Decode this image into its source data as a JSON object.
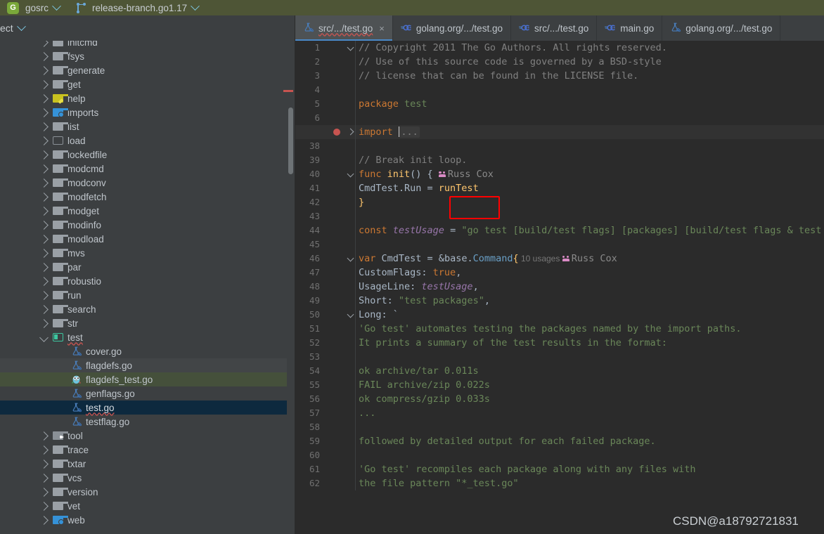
{
  "topbar": {
    "project_badge": "G",
    "project_name": "gosrc",
    "branch_icon": "vcs-branch-icon",
    "branch_name": "release-branch.go1.17",
    "project_chevron": "chevron-down-icon",
    "branch_chevron": "chevron-down-icon"
  },
  "sidebar_header": {
    "label": "ect",
    "chevron": "chevron-down-icon"
  },
  "tree": [
    {
      "label": "initcmd",
      "indent": 0,
      "arrow": "right",
      "icon": "folder",
      "state": "clipped"
    },
    {
      "label": "fsys",
      "indent": 0,
      "arrow": "right",
      "icon": "folder"
    },
    {
      "label": "generate",
      "indent": 0,
      "arrow": "right",
      "icon": "folder"
    },
    {
      "label": "get",
      "indent": 0,
      "arrow": "right",
      "icon": "folder"
    },
    {
      "label": "help",
      "indent": 0,
      "arrow": "right",
      "icon": "folder-yellow"
    },
    {
      "label": "imports",
      "indent": 0,
      "arrow": "right",
      "icon": "folder-blue"
    },
    {
      "label": "list",
      "indent": 0,
      "arrow": "right",
      "icon": "folder"
    },
    {
      "label": "load",
      "indent": 0,
      "arrow": "right",
      "icon": "folder-outline"
    },
    {
      "label": "lockedfile",
      "indent": 0,
      "arrow": "right",
      "icon": "folder"
    },
    {
      "label": "modcmd",
      "indent": 0,
      "arrow": "right",
      "icon": "folder"
    },
    {
      "label": "modconv",
      "indent": 0,
      "arrow": "right",
      "icon": "folder"
    },
    {
      "label": "modfetch",
      "indent": 0,
      "arrow": "right",
      "icon": "folder"
    },
    {
      "label": "modget",
      "indent": 0,
      "arrow": "right",
      "icon": "folder"
    },
    {
      "label": "modinfo",
      "indent": 0,
      "arrow": "right",
      "icon": "folder"
    },
    {
      "label": "modload",
      "indent": 0,
      "arrow": "right",
      "icon": "folder"
    },
    {
      "label": "mvs",
      "indent": 0,
      "arrow": "right",
      "icon": "folder"
    },
    {
      "label": "par",
      "indent": 0,
      "arrow": "right",
      "icon": "folder"
    },
    {
      "label": "robustio",
      "indent": 0,
      "arrow": "right",
      "icon": "folder"
    },
    {
      "label": "run",
      "indent": 0,
      "arrow": "right",
      "icon": "folder"
    },
    {
      "label": "search",
      "indent": 0,
      "arrow": "right",
      "icon": "folder"
    },
    {
      "label": "str",
      "indent": 0,
      "arrow": "right",
      "icon": "folder"
    },
    {
      "label": "test",
      "indent": 0,
      "arrow": "down",
      "icon": "folder-open-teal",
      "squiggle": true
    },
    {
      "label": "cover.go",
      "indent": 1,
      "arrow": "none",
      "icon": "go-test-file"
    },
    {
      "label": "flagdefs.go",
      "indent": 1,
      "arrow": "none",
      "icon": "go-test-file",
      "row": "hover"
    },
    {
      "label": "flagdefs_test.go",
      "indent": 1,
      "arrow": "none",
      "icon": "gopher-file",
      "row": "sel-green"
    },
    {
      "label": "genflags.go",
      "indent": 1,
      "arrow": "none",
      "icon": "go-test-file"
    },
    {
      "label": "test.go",
      "indent": 1,
      "arrow": "none",
      "icon": "go-test-file",
      "row": "sel-blue",
      "squiggle": true
    },
    {
      "label": "testflag.go",
      "indent": 1,
      "arrow": "none",
      "icon": "go-test-file"
    },
    {
      "label": "tool",
      "indent": 0,
      "arrow": "right",
      "icon": "folder-arrow"
    },
    {
      "label": "trace",
      "indent": 0,
      "arrow": "right",
      "icon": "folder"
    },
    {
      "label": "txtar",
      "indent": 0,
      "arrow": "right",
      "icon": "folder"
    },
    {
      "label": "vcs",
      "indent": 0,
      "arrow": "right",
      "icon": "folder"
    },
    {
      "label": "version",
      "indent": 0,
      "arrow": "right",
      "icon": "folder"
    },
    {
      "label": "vet",
      "indent": 0,
      "arrow": "right",
      "icon": "folder"
    },
    {
      "label": "web",
      "indent": 0,
      "arrow": "right",
      "icon": "folder-web"
    }
  ],
  "tabs": [
    {
      "label": "src/.../test.go",
      "icon": "go-test-file",
      "active": true,
      "close": "×"
    },
    {
      "label": "golang.org/.../test.go",
      "icon": "go-file",
      "active": false
    },
    {
      "label": "src/.../test.go",
      "icon": "go-file",
      "active": false
    },
    {
      "label": "main.go",
      "icon": "go-file",
      "active": false
    },
    {
      "label": "golang.org/.../test.go",
      "icon": "go-test-file",
      "active": false
    }
  ],
  "editor": {
    "lines": [
      {
        "n": "1",
        "fold": "down",
        "segs": [
          {
            "t": "// Copyright 2011 The Go Authors. All rights reserved.",
            "c": "cm"
          }
        ]
      },
      {
        "n": "2",
        "segs": [
          {
            "t": "// Use of this source code is governed by a BSD-style",
            "c": "cm"
          }
        ]
      },
      {
        "n": "3",
        "segs": [
          {
            "t": "// license that can be found in the LICENSE file.",
            "c": "cm"
          }
        ]
      },
      {
        "n": "4",
        "segs": []
      },
      {
        "n": "5",
        "segs": [
          {
            "t": "package ",
            "c": "kw"
          },
          {
            "t": "test",
            "c": "pkg"
          }
        ]
      },
      {
        "n": "6",
        "segs": []
      },
      {
        "n": "",
        "fold": "right",
        "breakpoint": true,
        "hl": true,
        "segs": [
          {
            "t": "import ",
            "c": "kw"
          },
          {
            "t": "CARET",
            "c": "caret"
          },
          {
            "t": "...",
            "c": "folded"
          }
        ]
      },
      {
        "n": "38",
        "segs": []
      },
      {
        "n": "39",
        "segs": [
          {
            "t": "// Break init loop.",
            "c": "cm"
          }
        ]
      },
      {
        "n": "40",
        "fold": "down",
        "segs": [
          {
            "t": "func ",
            "c": "kw"
          },
          {
            "t": "init",
            "c": "fn"
          },
          {
            "t": "() {",
            "c": "pln"
          },
          {
            "t": "  ",
            "c": "pln"
          },
          {
            "t": "PEOPLE",
            "c": "people"
          },
          {
            "t": "Russ Cox",
            "c": "inlay-user"
          }
        ]
      },
      {
        "n": "41",
        "segs": [
          {
            "t": "    CmdTest.Run = ",
            "c": "pln"
          },
          {
            "t": "runTest",
            "c": "fn"
          }
        ]
      },
      {
        "n": "42",
        "segs": [
          {
            "t": "    }",
            "c": "brace"
          }
        ]
      },
      {
        "n": "43",
        "segs": []
      },
      {
        "n": "44",
        "segs": [
          {
            "t": "const ",
            "c": "kw"
          },
          {
            "t": "testUsage",
            "c": "fld"
          },
          {
            "t": " = ",
            "c": "pln"
          },
          {
            "t": "\"go test [build/test flags] [packages] [build/test flags & test bin",
            "c": "str"
          }
        ]
      },
      {
        "n": "45",
        "segs": []
      },
      {
        "n": "46",
        "fold": "down",
        "segs": [
          {
            "t": "var ",
            "c": "kw"
          },
          {
            "t": "CmdTest",
            "c": "pln"
          },
          {
            "t": " = &",
            "c": "pln"
          },
          {
            "t": "base",
            "c": "pln"
          },
          {
            "t": ".",
            "c": "pln"
          },
          {
            "t": "Command",
            "c": "typ"
          },
          {
            "t": "{",
            "c": "brace"
          },
          {
            "t": "  10 usages  ",
            "c": "inlay"
          },
          {
            "t": "PEOPLE",
            "c": "people"
          },
          {
            "t": "Russ Cox",
            "c": "inlay-user"
          }
        ]
      },
      {
        "n": "47",
        "segs": [
          {
            "t": "    CustomFlags: ",
            "c": "pln"
          },
          {
            "t": "true",
            "c": "kw"
          },
          {
            "t": ",",
            "c": "pln"
          }
        ]
      },
      {
        "n": "48",
        "segs": [
          {
            "t": "    UsageLine:   ",
            "c": "pln"
          },
          {
            "t": "testUsage",
            "c": "fld"
          },
          {
            "t": ",",
            "c": "pln"
          }
        ]
      },
      {
        "n": "49",
        "segs": [
          {
            "t": "    Short:       ",
            "c": "pln"
          },
          {
            "t": "\"test packages\"",
            "c": "str"
          },
          {
            "t": ",",
            "c": "pln"
          }
        ]
      },
      {
        "n": "50",
        "fold": "down",
        "segs": [
          {
            "t": "    Long: `",
            "c": "pln"
          }
        ]
      },
      {
        "n": "51",
        "segs": [
          {
            "t": "'Go test' automates testing the packages named by the import paths.",
            "c": "str"
          }
        ]
      },
      {
        "n": "52",
        "segs": [
          {
            "t": "It prints a summary of the test results in the format:",
            "c": "str"
          }
        ]
      },
      {
        "n": "53",
        "segs": []
      },
      {
        "n": "54",
        "segs": [
          {
            "t": "    ok   archive/tar   0.011s",
            "c": "str"
          }
        ]
      },
      {
        "n": "55",
        "segs": [
          {
            "t": "    FAIL archive/zip   0.022s",
            "c": "str"
          }
        ]
      },
      {
        "n": "56",
        "segs": [
          {
            "t": "    ok   compress/gzip 0.033s",
            "c": "str"
          }
        ]
      },
      {
        "n": "57",
        "segs": [
          {
            "t": "    ...",
            "c": "str"
          }
        ]
      },
      {
        "n": "58",
        "segs": []
      },
      {
        "n": "59",
        "segs": [
          {
            "t": "followed by detailed output for each failed package.",
            "c": "str"
          }
        ]
      },
      {
        "n": "60",
        "segs": []
      },
      {
        "n": "61",
        "segs": [
          {
            "t": "'Go test' recompiles each package along with any files with",
            "c": "str"
          }
        ]
      },
      {
        "n": "62",
        "segs": [
          {
            "t": "the file pattern \"*_test.go\"",
            "c": "str"
          }
        ]
      }
    ]
  },
  "annotation": {
    "name": "red-highlight-box",
    "target": "runTest"
  },
  "watermark": {
    "text": "CSDN@a18792721831"
  }
}
